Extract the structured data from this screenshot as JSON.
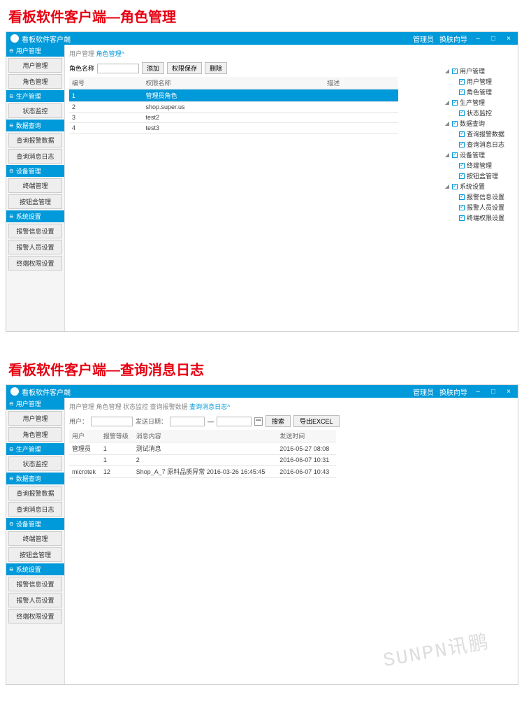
{
  "section1": {
    "title": "看板软件客户端—角色管理",
    "window_title": "看板软件客户端",
    "titlebar": {
      "user": "管理员",
      "switch": "换肤向导",
      "min": "–",
      "max": "□",
      "close": "×"
    },
    "sidebar": {
      "groups": [
        {
          "header": "用户管理",
          "items": [
            "用户管理",
            "角色管理"
          ]
        },
        {
          "header": "生产管理",
          "items": [
            "状态监控"
          ]
        },
        {
          "header": "数据查询",
          "items": [
            "查询报警数据",
            "查询消息日志"
          ]
        },
        {
          "header": "设备管理",
          "items": [
            "终端管理",
            "按钮盒管理"
          ]
        },
        {
          "header": "系统设置",
          "items": [
            "报警信息设置",
            "报警人员设置",
            "终端权限设置"
          ]
        }
      ]
    },
    "breadcrumb": [
      "用户管理",
      "角色管理"
    ],
    "toolbar": {
      "label_id": "角色名称",
      "btn_add": "添加",
      "btn_perm": "权限保存",
      "btn_del": "删除"
    },
    "table": {
      "headers": [
        "编号",
        "权限名称",
        "描述"
      ],
      "rows": [
        {
          "id": "1",
          "name": "管理员角色",
          "desc": "",
          "selected": true
        },
        {
          "id": "2",
          "name": "shop.super.us",
          "desc": ""
        },
        {
          "id": "3",
          "name": "test2",
          "desc": ""
        },
        {
          "id": "4",
          "name": "test3",
          "desc": ""
        }
      ]
    },
    "perm_tree": [
      {
        "label": "用户管理",
        "children": [
          {
            "label": "用户管理"
          },
          {
            "label": "角色管理"
          }
        ]
      },
      {
        "label": "生产管理",
        "children": [
          {
            "label": "状态监控"
          }
        ]
      },
      {
        "label": "数据查询",
        "children": [
          {
            "label": "查询报警数据"
          },
          {
            "label": "查询消息日志"
          }
        ]
      },
      {
        "label": "设备管理",
        "children": [
          {
            "label": "终端管理"
          },
          {
            "label": "按钮盒管理"
          }
        ]
      },
      {
        "label": "系统设置",
        "children": [
          {
            "label": "报警信息设置"
          },
          {
            "label": "报警人员设置"
          },
          {
            "label": "终端权限设置"
          }
        ]
      }
    ]
  },
  "section2": {
    "title": "看板软件客户端—查询消息日志",
    "window_title": "看板软件客户端",
    "titlebar": {
      "user": "管理员",
      "switch": "换肤向导",
      "min": "–",
      "max": "□",
      "close": "×"
    },
    "sidebar": {
      "groups": [
        {
          "header": "用户管理",
          "items": [
            "用户管理",
            "角色管理"
          ]
        },
        {
          "header": "生产管理",
          "items": [
            "状态监控"
          ]
        },
        {
          "header": "数据查询",
          "items": [
            "查询报警数据",
            "查询消息日志"
          ]
        },
        {
          "header": "设备管理",
          "items": [
            "终端管理",
            "按钮盒管理"
          ]
        },
        {
          "header": "系统设置",
          "items": [
            "报警信息设置",
            "报警人员设置",
            "终端权限设置"
          ]
        }
      ]
    },
    "breadcrumb": [
      "用户管理",
      "角色管理",
      "状态监控",
      "查询报警数据",
      "查询消息日志"
    ],
    "filter": {
      "label_user": "用户：",
      "label_date": "发送日期：",
      "sep": "—",
      "btn_search": "搜索",
      "btn_export": "导出EXCEL"
    },
    "table": {
      "headers": [
        "用户",
        "报警等级",
        "消息内容",
        "发送时间"
      ],
      "rows": [
        {
          "user": "管理员",
          "level": "1",
          "content": "测试消息",
          "time": "2016-05-27 08:08"
        },
        {
          "user": "",
          "level": "1",
          "content": "2",
          "time": "2016-06-07 10:31"
        },
        {
          "user": "microtek",
          "level": "12",
          "content": "Shop_A_7  原料品质异常 2016-03-26 16:45:45",
          "time": "2016-06-07 10:43"
        }
      ]
    },
    "watermark": "SUNPN讯鹏"
  }
}
